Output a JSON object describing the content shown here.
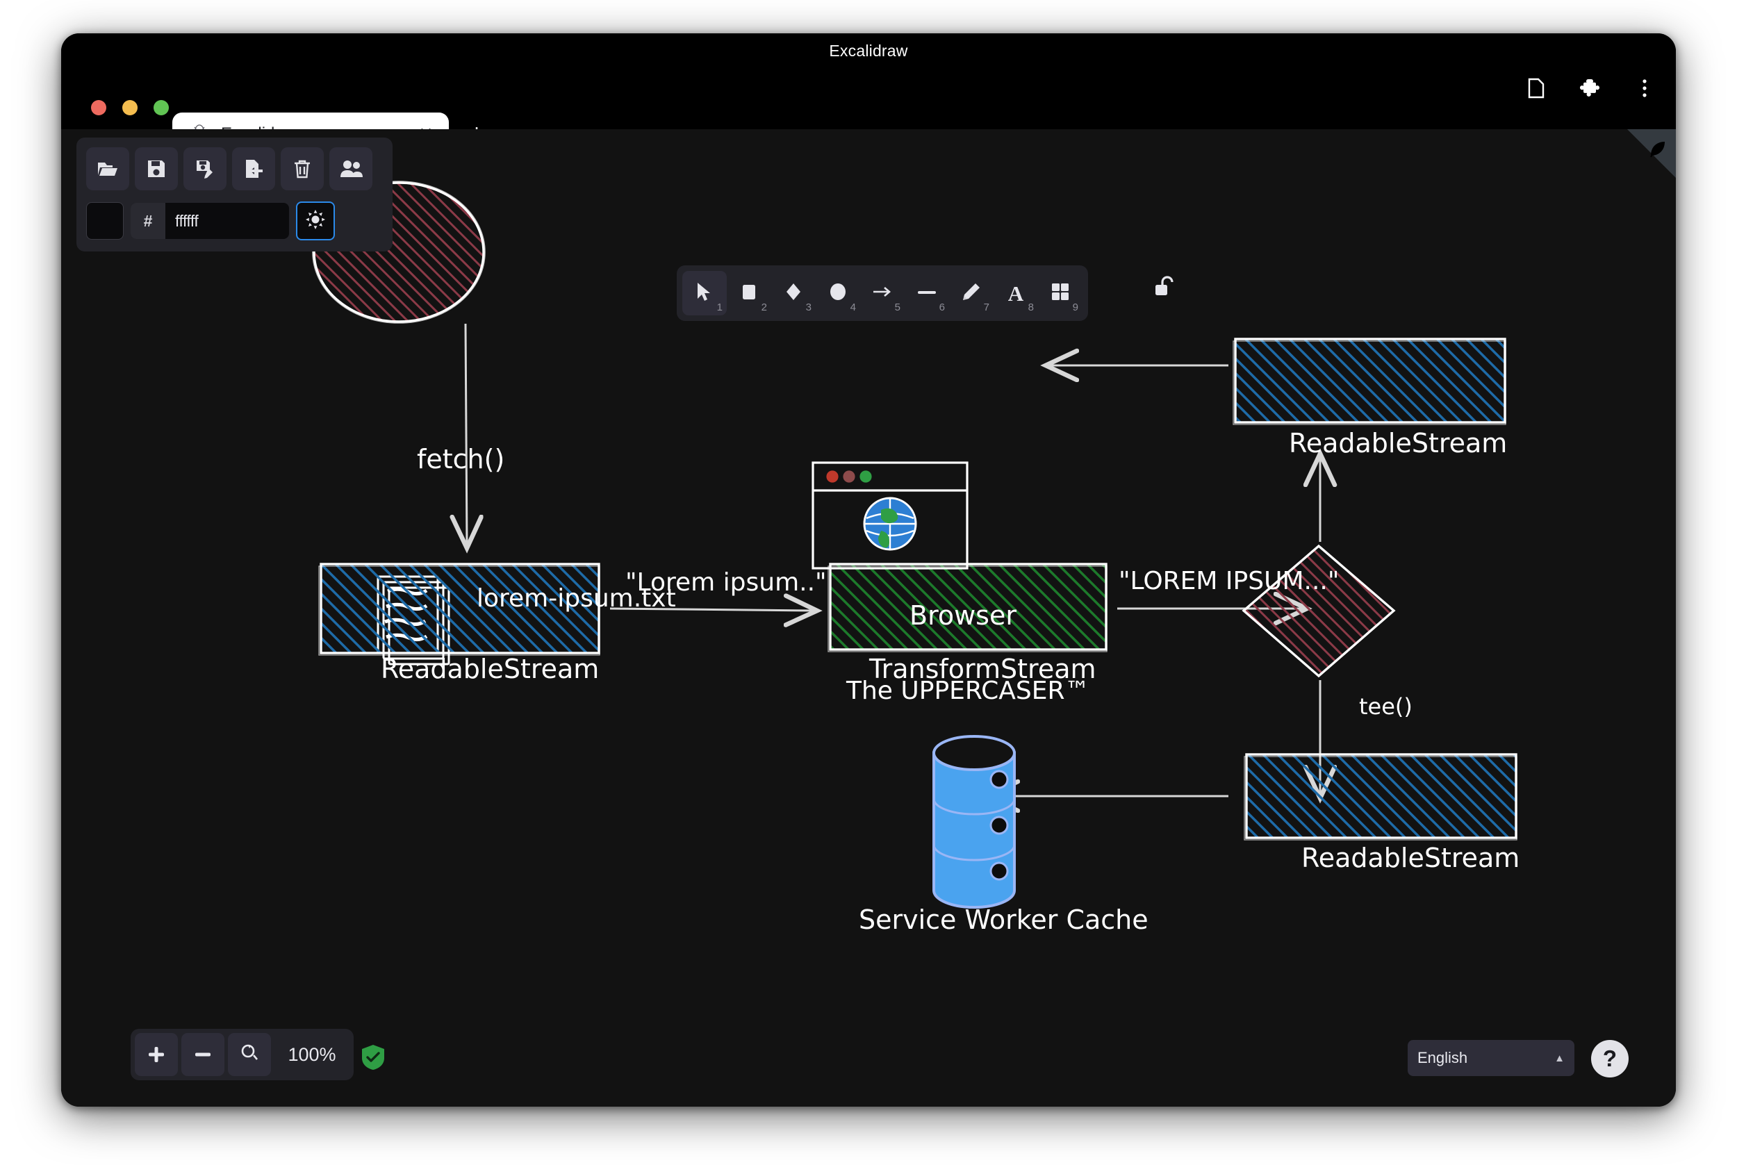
{
  "window": {
    "title": "Excalidraw",
    "traffic_lights": [
      "close",
      "minimize",
      "maximize"
    ]
  },
  "tab": {
    "label": "Excalidraw",
    "favicon": "excalidraw-favicon",
    "close_label": "✕",
    "new_tab_label": "+"
  },
  "chrome_actions": [
    {
      "name": "page-icon",
      "label": ""
    },
    {
      "name": "extensions-puzzle-icon",
      "label": ""
    },
    {
      "name": "overflow-menu-icon",
      "label": ""
    }
  ],
  "left_panel": {
    "buttons": [
      {
        "name": "open-folder-button",
        "title": "Open"
      },
      {
        "name": "save-button",
        "title": "Save"
      },
      {
        "name": "save-as-button",
        "title": "Save as"
      },
      {
        "name": "export-button",
        "title": "Export"
      },
      {
        "name": "trash-button",
        "title": "Reset the canvas"
      },
      {
        "name": "live-collaboration-button",
        "title": "Live collaboration"
      }
    ],
    "canvas_color": {
      "hash": "#",
      "value": "ffffff",
      "swatch_hex": "#0b0b0d"
    },
    "theme_button": {
      "name": "theme-toggle-button",
      "icon": "sun-icon",
      "accent": "#2b8aea"
    }
  },
  "toolbar": {
    "tools": [
      {
        "name": "selection-tool",
        "icon": "cursor-icon",
        "shortcut": "1",
        "active": true
      },
      {
        "name": "rectangle-tool",
        "icon": "square-icon",
        "shortcut": "2",
        "active": false
      },
      {
        "name": "diamond-tool",
        "icon": "diamond-icon",
        "shortcut": "3",
        "active": false
      },
      {
        "name": "ellipse-tool",
        "icon": "circle-icon",
        "shortcut": "4",
        "active": false
      },
      {
        "name": "arrow-tool",
        "icon": "arrow-icon",
        "shortcut": "5",
        "active": false
      },
      {
        "name": "line-tool",
        "icon": "line-icon",
        "shortcut": "6",
        "active": false
      },
      {
        "name": "draw-tool",
        "icon": "pencil-icon",
        "shortcut": "7",
        "active": false
      },
      {
        "name": "text-tool",
        "icon": "letter-a-icon",
        "shortcut": "8",
        "active": false
      },
      {
        "name": "library-tool",
        "icon": "grid-squares-icon",
        "shortcut": "9",
        "active": false
      }
    ],
    "lock": {
      "name": "keep-selected-tool-active-button",
      "icon": "unlocked-padlock-icon"
    }
  },
  "footer": {
    "zoom_in": "+",
    "zoom_out": "−",
    "zoom_reset_icon": "reset-zoom-icon",
    "zoom_value": "100%",
    "encryption_badge": "shield-check-icon",
    "language": "English",
    "language_caret": "▲",
    "help": "?"
  },
  "canvas": {
    "background": "#121212",
    "shapes": [
      {
        "id": "fetch",
        "type": "ellipse",
        "label": "fetch()",
        "fill": "#8b3a47",
        "stroke": "#ffffff"
      },
      {
        "id": "rs1",
        "type": "rectangle",
        "label": "ReadableStream",
        "fill": "#1e6ba8",
        "stroke": "#ffffff"
      },
      {
        "id": "transform",
        "type": "rectangle",
        "label": "TransformStream",
        "fill": "#1d7a2b",
        "stroke": "#ffffff"
      },
      {
        "id": "tee",
        "type": "diamond",
        "label": "tee()",
        "fill": "#8b3a47",
        "stroke": "#ffffff"
      },
      {
        "id": "rs2",
        "type": "rectangle",
        "label": "ReadableStream",
        "fill": "#1e6ba8",
        "stroke": "#ffffff"
      },
      {
        "id": "rs3",
        "type": "rectangle",
        "label": "ReadableStream",
        "fill": "#1e6ba8",
        "stroke": "#ffffff"
      },
      {
        "id": "browser",
        "type": "browser-window-icon",
        "label": "Browser",
        "stroke": "#ffffff"
      },
      {
        "id": "cache",
        "type": "database-cylinder-icon",
        "label": "Service Worker Cache",
        "fill": "#4aa3ef",
        "stroke": "#9ab6f5"
      },
      {
        "id": "docs",
        "type": "document-stack-icon",
        "label": "",
        "stroke": "#ffffff"
      }
    ],
    "labels": [
      {
        "id": "file-label",
        "text": "lorem-ipsum.txt"
      },
      {
        "id": "lorem-label",
        "text": "\"Lorem ipsum..\""
      },
      {
        "id": "uppercase-label",
        "text": "\"LOREM IPSUM...\""
      },
      {
        "id": "uppercaser-caption",
        "text": "The UPPERCASER™"
      },
      {
        "id": "browser-caption",
        "text": "Browser"
      },
      {
        "id": "cache-caption",
        "text": "Service Worker Cache"
      }
    ]
  }
}
